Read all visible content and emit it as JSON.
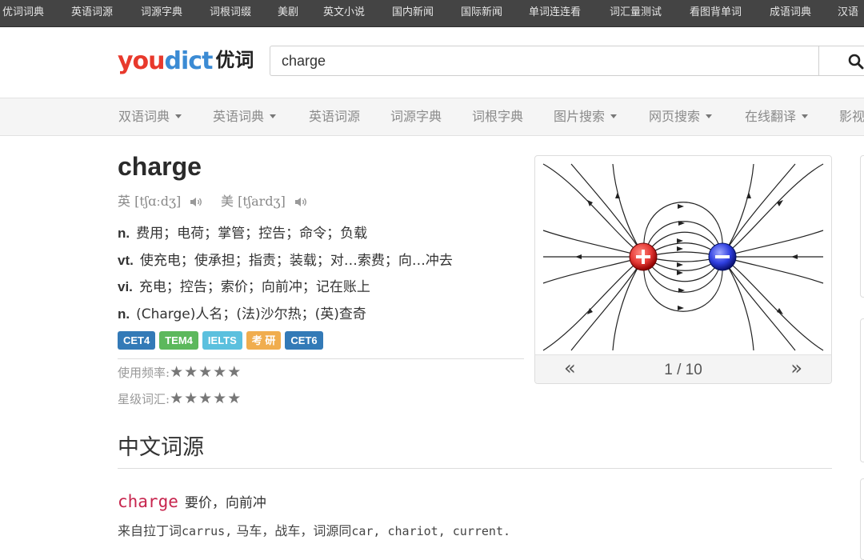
{
  "topbar": {
    "items": [
      "优词词典",
      "英语词源",
      "词源字典",
      "词根词缀",
      "美剧",
      "英文小说",
      "国内新闻",
      "国际新闻",
      "单词连连看",
      "词汇量测试",
      "看图背单词",
      "成语词典",
      "汉语"
    ]
  },
  "header": {
    "logo": {
      "part1": "you",
      "part2": "dict",
      "part3": "优词"
    },
    "search": {
      "value": "charge"
    }
  },
  "nav": {
    "items": [
      {
        "label": "双语词典",
        "dropdown": true
      },
      {
        "label": "英语词典",
        "dropdown": true
      },
      {
        "label": "英语词源",
        "dropdown": false
      },
      {
        "label": "词源字典",
        "dropdown": false
      },
      {
        "label": "词根字典",
        "dropdown": false
      },
      {
        "label": "图片搜索",
        "dropdown": true
      },
      {
        "label": "网页搜索",
        "dropdown": true
      },
      {
        "label": "在线翻译",
        "dropdown": true
      },
      {
        "label": "影视",
        "dropdown": false
      }
    ]
  },
  "entry": {
    "word": "charge",
    "phonetics": {
      "uk_label": "英",
      "uk": "[tʃɑːdʒ]",
      "us_label": "美",
      "us": "[tʃardʒ]"
    },
    "definitions": [
      {
        "pos": "n.",
        "text": "费用；电荷；掌管；控告；命令；负载"
      },
      {
        "pos": "vt.",
        "text": "使充电；使承担；指责；装载；对…索费；向…冲去"
      },
      {
        "pos": "vi.",
        "text": "充电；控告；索价；向前冲；记在账上"
      },
      {
        "pos": "n.",
        "text": "(Charge)人名；(法)沙尔热；(英)查奇"
      }
    ],
    "tags": [
      {
        "label": "CET4",
        "color": "#337ab7"
      },
      {
        "label": "TEM4",
        "color": "#5cb85c"
      },
      {
        "label": "IELTS",
        "color": "#5bc0de"
      },
      {
        "label": "考 研",
        "color": "#f0ad4e"
      },
      {
        "label": "CET6",
        "color": "#337ab7"
      }
    ],
    "frequency": {
      "label": "使用频率:",
      "stars": "★★★★★"
    },
    "level": {
      "label": "星级词汇:",
      "stars": "★★★★★"
    }
  },
  "etymology": {
    "title": "中文词源",
    "word": "charge",
    "gloss": "要价，向前冲",
    "body_prefix": "来自拉丁词",
    "body_latin": "carrus,",
    "body_mid": " 马车，战车，词源同",
    "body_refs": "car, chariot, current."
  },
  "image_panel": {
    "image_icon": "electric-field-lines-dipole",
    "pager": {
      "prev": "«",
      "counter": "1 / 10",
      "next": "»"
    }
  },
  "colors": {
    "logo_red": "#e8392c",
    "logo_blue": "#3b8bd4",
    "topbar_bg": "#444444",
    "etym_word": "#c7254e"
  }
}
